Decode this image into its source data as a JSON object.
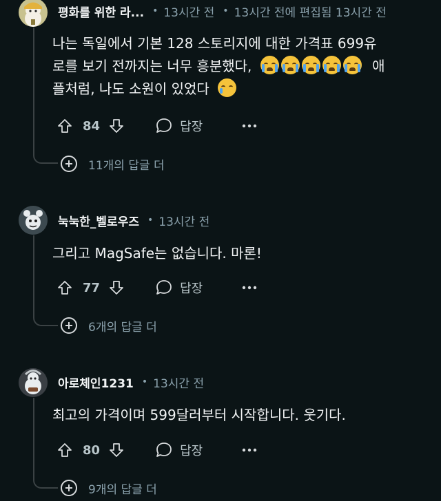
{
  "comments": [
    {
      "author": "평화를 위한 라...",
      "time": "13시간 전",
      "edited": "13시간 전에 편집됨 13시간 전",
      "body_line1": "나는 독일에서 기본 128 스토리지에 대한 가격표 699유",
      "body_line2a": "로를 보기 전까지는 너무 흥분했다,",
      "body_line2b": "애",
      "body_line3": "플처럼, 나도 소원이 있었다",
      "votes": "84",
      "reply_label": "답장",
      "more_replies": "11개의 답글 더"
    },
    {
      "author": "눅눅한_벨로우즈",
      "time": "13시간 전",
      "body": "그리고 MagSafe는 없습니다. 마론!",
      "votes": "77",
      "reply_label": "답장",
      "more_replies": "6개의 답글 더"
    },
    {
      "author": "아로체인1231",
      "time": "13시간 전",
      "body": "최고의 가격이며 599달러부터 시작합니다. 웃기다.",
      "votes": "80",
      "reply_label": "답장",
      "more_replies": "9개의 답글 더"
    }
  ],
  "icons": {
    "upvote": "upvote-icon",
    "downvote": "downvote-icon",
    "reply": "speech-bubble-icon",
    "more": "ellipsis-icon",
    "expand": "plus-circle-icon",
    "emoji_crying": "loudly-crying-face-icon",
    "emoji_holding_tears": "face-holding-back-tears-icon"
  },
  "colors": {
    "background": "#0b1416",
    "text": "#f2f4f5",
    "meta": "#8ba2ad",
    "thread_line": "#3b4244"
  }
}
